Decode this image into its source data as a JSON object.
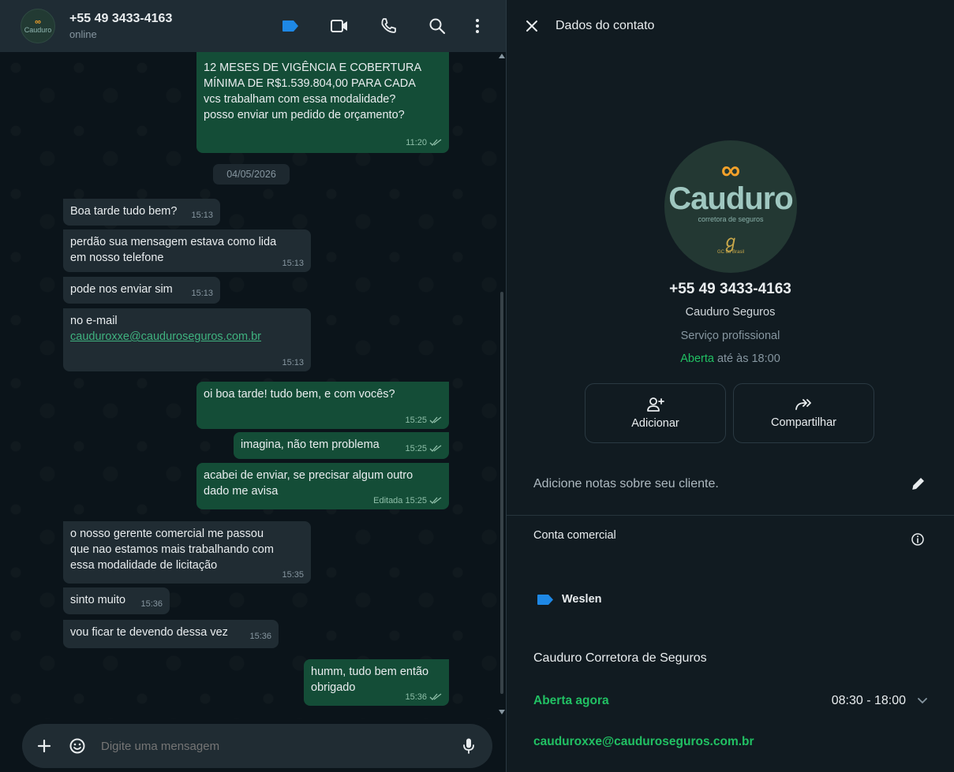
{
  "chat": {
    "contact_name": "+55 49 3433-4163",
    "status": "online",
    "avatar_top": "∞",
    "avatar_text": "Cauduro",
    "date_chip": "04/05/2026",
    "messages": [
      {
        "dir": "out",
        "text": "12 MESES DE VIGÊNCIA E COBERTURA\nMÍNIMA DE R$1.539.804,00 PARA CADA\nvcs trabalham com essa modalidade?\nposso enviar um pedido de orçamento?",
        "time": "11:20"
      },
      {
        "dir": "in",
        "text": "Boa tarde tudo bem?",
        "time": "15:13"
      },
      {
        "dir": "in",
        "text": "perdão sua mensagem estava como lida\nem nosso telefone",
        "time": "15:13"
      },
      {
        "dir": "in",
        "text": "pode nos enviar sim",
        "time": "15:13"
      },
      {
        "dir": "in",
        "text": "no e-mail",
        "link": "cauduroxxe@cauduroseguros.com.br",
        "time": "15:13"
      },
      {
        "dir": "out",
        "text": "oi boa tarde! tudo bem, e com vocês?",
        "time": "15:25"
      },
      {
        "dir": "out",
        "text": "imagina, não tem problema",
        "time": "15:25"
      },
      {
        "dir": "out",
        "text": "acabei de enviar, se precisar algum outro\ndado me avisa",
        "time": "Editada 15:25"
      },
      {
        "dir": "in",
        "text": "o nosso gerente comercial me passou\nque nao estamos mais trabalhando com\nessa modalidade de licitação",
        "time": "15:35"
      },
      {
        "dir": "in",
        "text": "sinto muito",
        "time": "15:36"
      },
      {
        "dir": "in",
        "text": "vou ficar te devendo dessa vez",
        "time": "15:36"
      },
      {
        "dir": "out",
        "text": "humm, tudo bem então\nobrigado",
        "time": "15:36"
      }
    ],
    "composer_placeholder": "Digite uma mensagem"
  },
  "panel": {
    "title": "Dados do contato",
    "avatar": {
      "top": "∞",
      "brand": "Cauduro",
      "sub": "corretora de seguros",
      "mark": "ℊ",
      "mark_sub": "GC do Brasil"
    },
    "phone": "+55 49 3433-4163",
    "name": "Cauduro Seguros",
    "category": "Serviço profissional",
    "open_status": "Aberta",
    "open_until": "até às 18:00",
    "actions": {
      "add": "Adicionar",
      "share": "Compartilhar"
    },
    "notes_placeholder": "Adicione notas sobre seu cliente.",
    "business_account": "Conta comercial",
    "label_name": "Weslen",
    "business_name": "Cauduro Corretora de Seguros",
    "open_now": "Aberta agora",
    "hours": "08:30 - 18:00",
    "email": "cauduroxxe@cauduroseguros.com.br"
  },
  "colors": {
    "accent_green": "#21c063",
    "label_blue": "#1e88e5",
    "out_bubble": "#144d37",
    "in_bubble": "#202c33"
  }
}
